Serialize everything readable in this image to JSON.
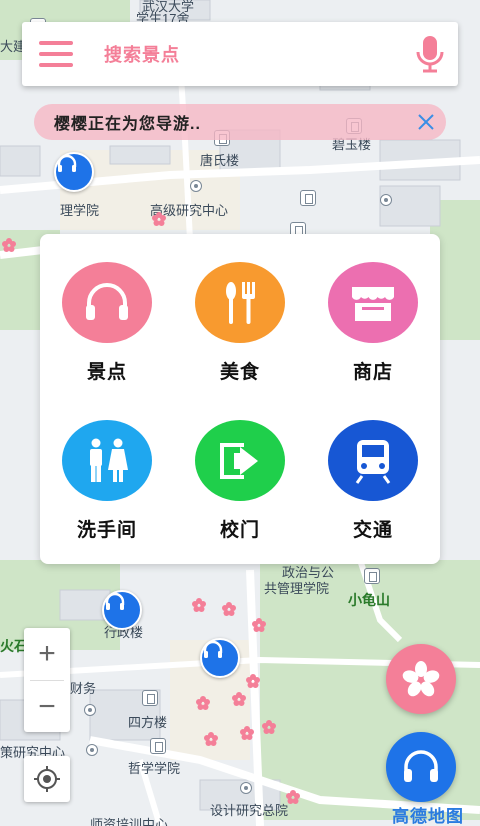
{
  "search": {
    "placeholder_text": "搜索景点"
  },
  "guide": {
    "message": "樱樱正在为您导游.."
  },
  "categories": [
    {
      "label": "景点",
      "color": "#f47f98",
      "icon": "headphones-icon"
    },
    {
      "label": "美食",
      "color": "#f89a2f",
      "icon": "utensils-icon"
    },
    {
      "label": "商店",
      "color": "#ec6fb0",
      "icon": "store-icon"
    },
    {
      "label": "洗手间",
      "color": "#1fa7ef",
      "icon": "restroom-icon"
    },
    {
      "label": "校门",
      "color": "#1fcf4b",
      "icon": "exit-icon"
    },
    {
      "label": "交通",
      "color": "#1757d4",
      "icon": "train-icon"
    }
  ],
  "map": {
    "labels": [
      {
        "text": "武汉大学"
      },
      {
        "text": "学生17舍"
      },
      {
        "text": "大建"
      },
      {
        "text": "唐氏楼"
      },
      {
        "text": "碧玉楼"
      },
      {
        "text": "理学院"
      },
      {
        "text": "高级研究中心"
      },
      {
        "text": "政治与公"
      },
      {
        "text": "共管理学院"
      },
      {
        "text": "小龟山"
      },
      {
        "text": "火石"
      },
      {
        "text": "行政楼"
      },
      {
        "text": "财务"
      },
      {
        "text": "四方楼"
      },
      {
        "text": "策研究中心"
      },
      {
        "text": "哲学学院"
      },
      {
        "text": "设计研究总院"
      },
      {
        "text": "师资培训中心"
      }
    ],
    "logo": "高德地图"
  },
  "zoom": {
    "in_label": "+",
    "out_label": "−"
  },
  "colors": {
    "accent_pink": "#f47f98",
    "accent_blue": "#1e73e8",
    "banner_bg": "#f6b6c4"
  }
}
